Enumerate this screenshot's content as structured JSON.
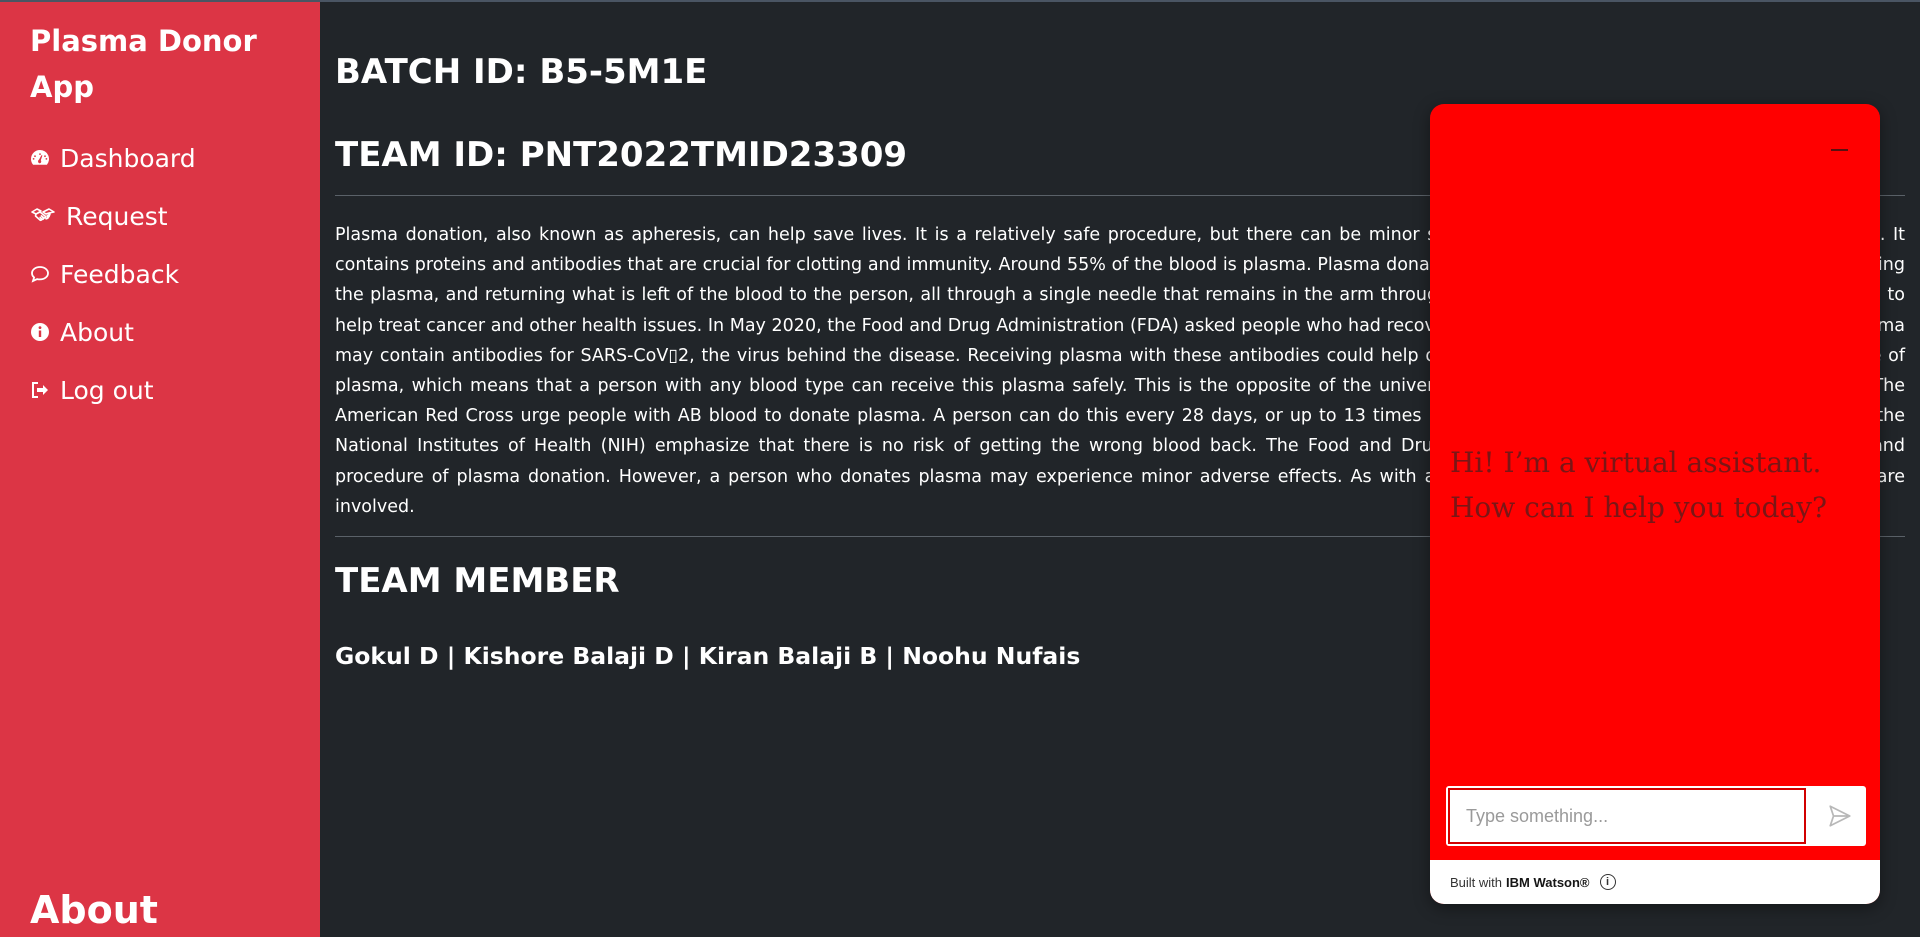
{
  "sidebar": {
    "brand": "Plasma Donor App",
    "items": [
      {
        "label": "Dashboard",
        "icon": "dashboard-icon"
      },
      {
        "label": "Request",
        "icon": "handshake-icon"
      },
      {
        "label": "Feedback",
        "icon": "comment-icon"
      },
      {
        "label": "About",
        "icon": "info-icon"
      },
      {
        "label": "Log out",
        "icon": "logout-icon"
      }
    ],
    "footer_heading": "About"
  },
  "main": {
    "batch_id": "BATCH ID: B5-5M1E",
    "team_id": "TEAM ID: PNT2022TMID23309",
    "description": "Plasma donation, also known as apheresis, can help save lives. It is a relatively safe procedure, but there can be minor side effects. Plasma is the liquid part of the blood. It contains proteins and antibodies that are crucial for clotting and immunity. Around 55% of the blood is plasma. Plasma donation involves drawing blood, separating and collecting the plasma, and returning what is left of the blood to the person, all through a single needle that remains in the arm throughout the procedure. Plasma donation can be used to help treat cancer and other health issues. In May 2020, the Food and Drug Administration (FDA) asked people who had recovered from COVID-19 to donate plasma, as the plasma may contain antibodies for SARS-CoV▯2, the virus behind the disease. Receiving plasma with these antibodies could help others. People with AB blood have a universal type of plasma, which means that a person with any blood type can receive this plasma safely. This is the opposite of the universal type of red blood cells, which is O negative. The American Red Cross urge people with AB blood to donate plasma. A person can do this every 28 days, or up to 13 times per year. Generally, plasma donation is safe, and the National Institutes of Health (NIH) emphasize that there is no risk of getting the wrong blood back. The Food and Drug Administration (FDA) regulate the equipment and procedure of plasma donation. However, a person who donates plasma may experience minor adverse effects. As with any procedure involving a puncture, certain risks are involved.",
    "member_heading": "TEAM MEMBER",
    "members": "Gokul D | Kishore Balaji D | Kiran Balaji B | Noohu Nufais"
  },
  "chat": {
    "greeting": "Hi! I’m a virtual assistant. How can I help you today?",
    "input_placeholder": "Type something...",
    "footer_prefix": "Built with",
    "footer_brand": "IBM Watson®",
    "accent": "#ff0000"
  },
  "colors": {
    "sidebar": "#dc3545",
    "background": "#212529"
  }
}
